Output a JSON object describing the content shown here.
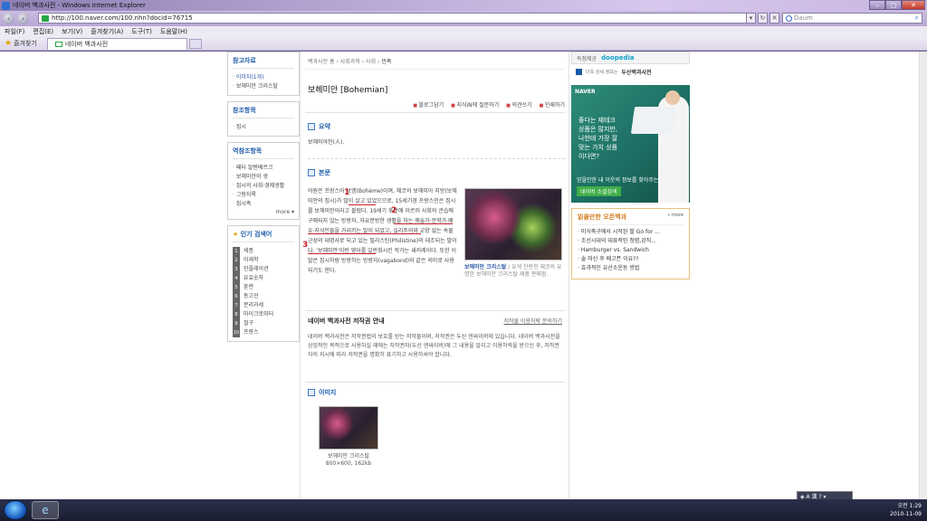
{
  "window": {
    "title": "네이버 백과사전 - Windows Internet Explorer",
    "url": "http://100.naver.com/100.nhn?docid=76715",
    "search_placeholder": "Daum"
  },
  "menu": [
    "파일(F)",
    "편집(E)",
    "보기(V)",
    "즐겨찾기(A)",
    "도구(T)",
    "도움말(H)"
  ],
  "favorites_label": "즐겨찾기",
  "tab_title": "네이버 백과사전",
  "left": {
    "ref_title": "참고자료",
    "ref_items": [
      "이미지(1개)",
      "보헤미안 크리스탈"
    ],
    "refitem_title": "참조항목",
    "refitem_items": [
      "집시"
    ],
    "related_title": "역참조항목",
    "related_items": [
      "페터 알텐베르크",
      "보헤미안의 생",
      "집시의 사회·경제생활",
      "그랑지록",
      "집시족"
    ],
    "more": "more ▾",
    "popular_title": "인기 검색어",
    "popular_items": [
      "세종",
      "이재학",
      "인플레이션",
      "유효숫자",
      "훈련",
      "동고선",
      "분리과세",
      "마이크로미터",
      "절구",
      "프랑스"
    ]
  },
  "center": {
    "breadcrumb": [
      "백과사전 홈",
      "사회과학",
      "사회",
      "민족"
    ],
    "title": "보헤미안 [Bohemian]",
    "tools": [
      "블로그담기",
      "지식iN에 질문하기",
      "의견쓰기",
      "인쇄하기"
    ],
    "summary_title": "요약",
    "summary": "보헤미아인(人).",
    "body_title": "본문",
    "body_text": "어원은 프랑스어 보엠(Bohème)이며, 체코의 보헤미아 지방(보헤미안의 집시)가 많이 살고 있었으므로, 15세기경 프랑스인은 집시를 보헤미안이라고 불렀다. 19세기 후반에 이르러 사회의 관습에 구애되지 않는 방랑자, 자유분방한 생활을 하는 예술가·문학가·배우·지식인들을 가리키는 말이 되었고, 실리주의와 교양 없는 속물근성의 대명사로 되고 있는 필리스틴(Philistine)의 대조되는 말이다. '보헤미안'이란 영어를 일반화시킨 작가는 새커레이다. 또한 이 말은 집시처럼 방랑하는 방랑자(vagabond)와 같은 의미로 사용되기도 한다.",
    "annotations": [
      "1",
      "2",
      "3"
    ],
    "photo_caption_link": "보헤미안 크리스탈",
    "photo_caption_text": " / 유색 찬란한 체코의 유명한 보헤미안 크리스탈 제품 판매점.",
    "copyright_title": "네이버 백과사전 저작권 안내",
    "copyright_link": "저작물 이용허락 문의하기",
    "copyright_text": "네이버 백과사전은 저작권법의 보호를 받는 저작물이며, 저작권은 두산 엔싸이버에 있습니다. 네이버 백과사전을 상업적인 목적으로 사용하실 때에는 저작권자(두산 엔싸이버)에 그 내용을 알리고 이용허락을 받으신 후, 저작권자의 지시에 따라 저작권을 명확히 표기하고 사용하셔야 합니다.",
    "images_title": "이미지",
    "image_caption": "보헤미안 크리스탈",
    "image_size": "800×600, 162kb"
  },
  "right": {
    "dp_label": "독점제공",
    "dp_brand": "doopedia",
    "dp_sub_text": "더욱 상세 정보는",
    "dp_sub_bold": "두산백과사전",
    "ad_brand": "NAVER",
    "ad_copy": "좋다는 재테크 상품은 많지만, 나한테 가장 잘 맞는 가치 상품이다면?",
    "ad_msg": "믿을만한 내 이웃의 정보를 찾아주는",
    "ad_cta": "네이버 소셜검색",
    "rec_title": "읽을만한 오픈백과",
    "rec_more": "» more",
    "rec_items": [
      "미식축구에서 시작된 팔 Go for ...",
      "조선시대의 대표적인 청렴,강직...",
      "Hamburger vs. Sandwich",
      "술 마신 후 배고픈 이유??",
      "효과적인 유산소운동 방법"
    ]
  },
  "taskbar": {
    "time": "오전 1:29",
    "date": "2010-11-09"
  }
}
